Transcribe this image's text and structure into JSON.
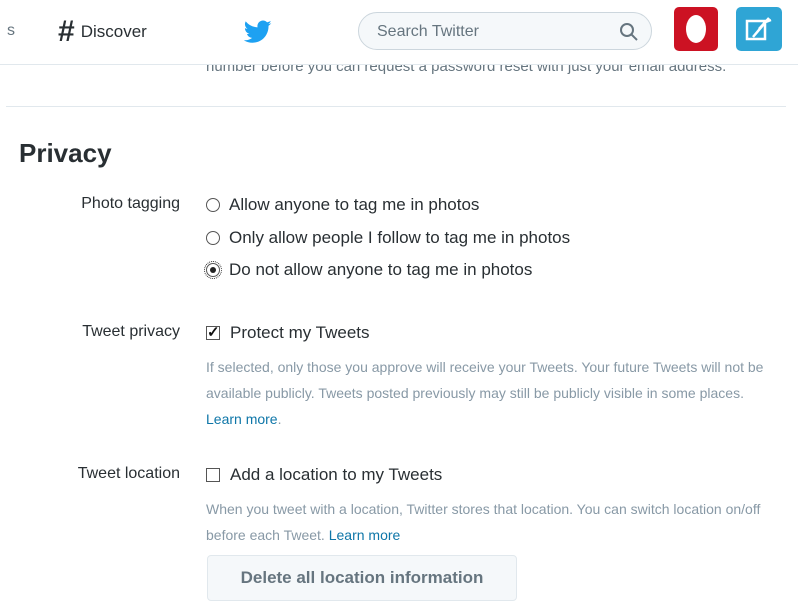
{
  "nav": {
    "fragment": "s",
    "discover_label": "Discover",
    "search_placeholder": "Search Twitter"
  },
  "colors": {
    "accent": "#2fa5d5",
    "red_app": "#cc1223",
    "link": "#0e76a8"
  },
  "icons": [
    "hash-icon",
    "twitter-bird-icon",
    "search-icon",
    "red-app-icon",
    "compose-tweet-icon"
  ],
  "clipped_text": "number before you can request a password reset with just your email address.",
  "privacy": {
    "title": "Privacy",
    "photo_tagging": {
      "label": "Photo tagging",
      "options": [
        {
          "label": "Allow anyone to tag me in photos",
          "checked": false
        },
        {
          "label": "Only allow people I follow to tag me in photos",
          "checked": false
        },
        {
          "label": "Do not allow anyone to tag me in photos",
          "checked": true
        }
      ]
    },
    "tweet_privacy": {
      "label": "Tweet privacy",
      "checkbox_label": "Protect my Tweets",
      "checked": true,
      "help": "If selected, only those you approve will receive your Tweets. Your future Tweets will not be available publicly. Tweets posted previously may still be publicly visible in some places.",
      "link": "Learn more",
      "after_link": "."
    },
    "tweet_location": {
      "label": "Tweet location",
      "checkbox_label": "Add a location to my Tweets",
      "checked": false,
      "help": "When you tweet with a location, Twitter stores that location. You can switch location on/off before each Tweet.",
      "link": "Learn more",
      "button": "Delete all location information"
    }
  }
}
